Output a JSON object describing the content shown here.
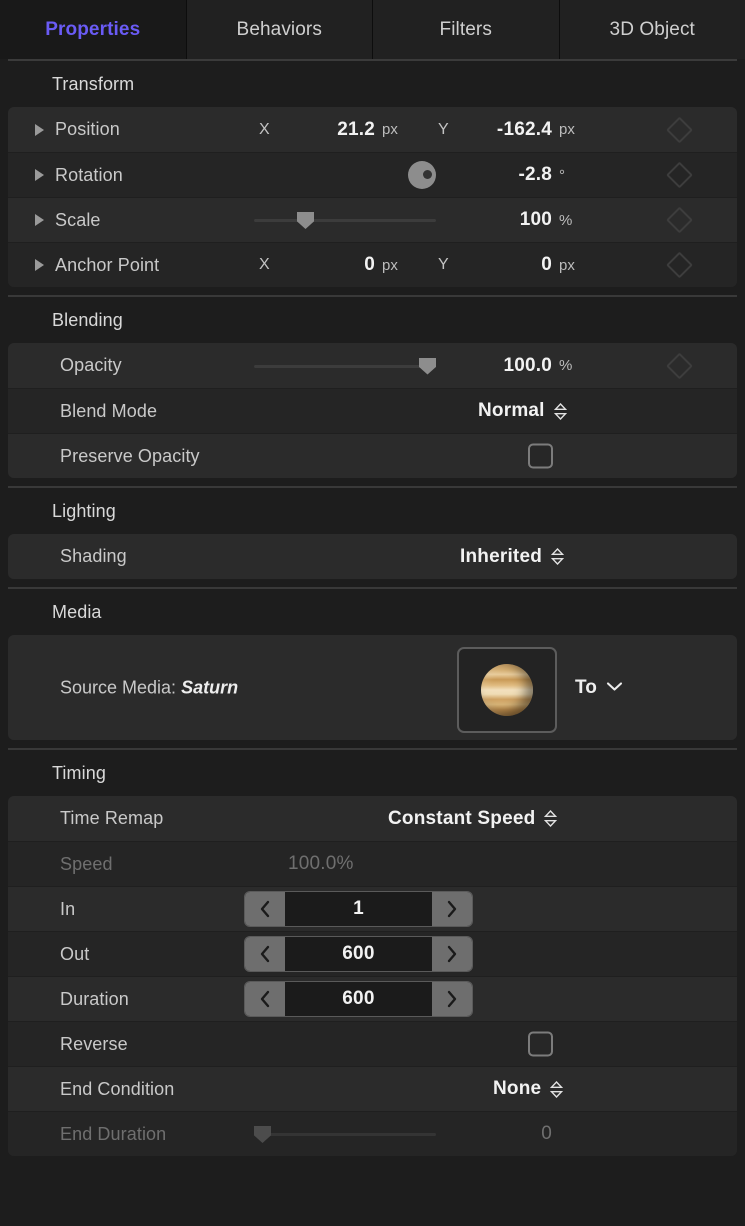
{
  "tabs": [
    {
      "label": "Properties",
      "active": true
    },
    {
      "label": "Behaviors",
      "active": false
    },
    {
      "label": "Filters",
      "active": false
    },
    {
      "label": "3D Object",
      "active": false
    }
  ],
  "accent_color": "#6a5bf5",
  "sections": {
    "transform": {
      "title": "Transform",
      "rows": {
        "position": {
          "label": "Position",
          "x_axis": "X",
          "x_value": "21.2",
          "x_unit": "px",
          "y_axis": "Y",
          "y_value": "-162.4",
          "y_unit": "px"
        },
        "rotation": {
          "label": "Rotation",
          "value": "-2.8",
          "unit": "°"
        },
        "scale": {
          "label": "Scale",
          "value": "100",
          "unit": "%"
        },
        "anchor_point": {
          "label": "Anchor Point",
          "x_axis": "X",
          "x_value": "0",
          "x_unit": "px",
          "y_axis": "Y",
          "y_value": "0",
          "y_unit": "px"
        }
      }
    },
    "blending": {
      "title": "Blending",
      "rows": {
        "opacity": {
          "label": "Opacity",
          "value": "100.0",
          "unit": "%"
        },
        "blend_mode": {
          "label": "Blend Mode",
          "value": "Normal"
        },
        "preserve_opacity": {
          "label": "Preserve Opacity",
          "checked": false
        }
      }
    },
    "lighting": {
      "title": "Lighting",
      "rows": {
        "shading": {
          "label": "Shading",
          "value": "Inherited"
        }
      }
    },
    "media": {
      "title": "Media",
      "source_media_label": "Source Media:",
      "source_media_name": "Saturn",
      "thumbnail_icon": "planet-saturn-thumbnail",
      "to_dropdown": "To"
    },
    "timing": {
      "title": "Timing",
      "rows": {
        "time_remap": {
          "label": "Time Remap",
          "value": "Constant Speed"
        },
        "speed": {
          "label": "Speed",
          "value": "100.0%"
        },
        "in": {
          "label": "In",
          "value": "1"
        },
        "out": {
          "label": "Out",
          "value": "600"
        },
        "duration": {
          "label": "Duration",
          "value": "600"
        },
        "reverse": {
          "label": "Reverse",
          "checked": false
        },
        "end_condition": {
          "label": "End Condition",
          "value": "None"
        },
        "end_duration": {
          "label": "End Duration",
          "value": "0"
        }
      }
    }
  }
}
